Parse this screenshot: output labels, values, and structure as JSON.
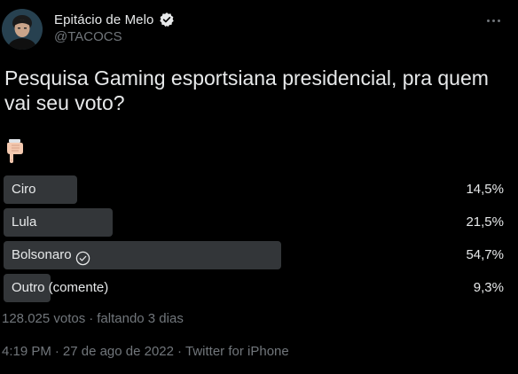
{
  "author": {
    "display_name": "Epitácio de Melo",
    "handle": "@TACOCS",
    "verified": true
  },
  "tweet": {
    "text": "Pesquisa Gaming esportsiana presidencial, pra quem vai seu voto?",
    "emoji_icon": "backhand-index-pointing-down-icon"
  },
  "poll": {
    "options": [
      {
        "label": "Ciro",
        "percent_text": "14,5%",
        "percent": 14.5,
        "voted": false
      },
      {
        "label": "Lula",
        "percent_text": "21,5%",
        "percent": 21.5,
        "voted": false
      },
      {
        "label": "Bolsonaro",
        "percent_text": "54,7%",
        "percent": 54.7,
        "voted": true
      },
      {
        "label": "Outro (comente)",
        "percent_text": "9,3%",
        "percent": 9.3,
        "voted": false
      }
    ],
    "votes_text": "128.025 votos",
    "separator": "·",
    "time_left_text": "faltando 3 dias"
  },
  "meta": {
    "time": "4:19 PM",
    "separator": "·",
    "date": "27 de ago de 2022",
    "source": "Twitter for iPhone"
  },
  "colors": {
    "background": "#000000",
    "text": "#e7e9ea",
    "secondary_text": "#71767b",
    "poll_bar": "#333639"
  }
}
